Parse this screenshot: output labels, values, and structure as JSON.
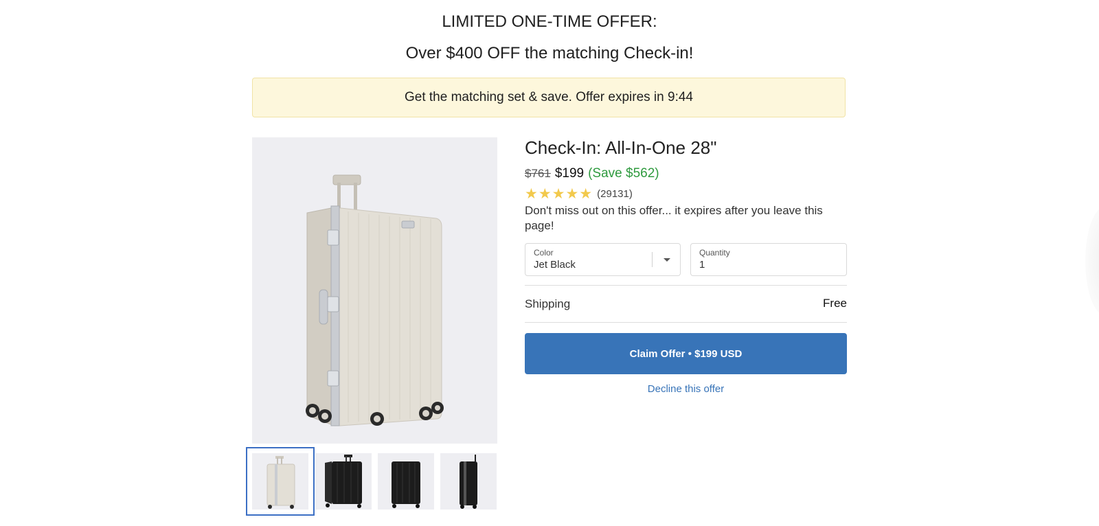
{
  "header": {
    "line1": "LIMITED ONE-TIME OFFER:",
    "line2": "Over $400 OFF the matching Check-in!"
  },
  "banner": {
    "text": "Get the matching set & save. Offer expires in 9:44"
  },
  "product": {
    "title": "Check-In: All-In-One 28\"",
    "original_price": "$761",
    "price": "$199",
    "savings": "(Save $562)",
    "stars": "★★★★★",
    "rating_value": 5,
    "review_count": "(29131)",
    "promo_text": "Don't miss out on this offer... it expires after you leave this page!"
  },
  "options": {
    "color_label": "Color",
    "color_value": "Jet Black",
    "quantity_label": "Quantity",
    "quantity_value": "1"
  },
  "shipping": {
    "label": "Shipping",
    "value": "Free"
  },
  "actions": {
    "claim_label": "Claim Offer • $199 USD",
    "decline_label": "Decline this offer"
  },
  "gallery": {
    "main_color": "#d9d4cb",
    "thumbnails": [
      {
        "name": "cream-front",
        "color": "#d9d4cb"
      },
      {
        "name": "black-angle",
        "color": "#1c1c1c"
      },
      {
        "name": "black-front",
        "color": "#1c1c1c"
      },
      {
        "name": "black-side",
        "color": "#1c1c1c"
      }
    ]
  },
  "colors": {
    "accent": "#3874b8",
    "save_green": "#2e9a3e",
    "star": "#f2c94c",
    "banner_bg": "#fdf7dc"
  }
}
